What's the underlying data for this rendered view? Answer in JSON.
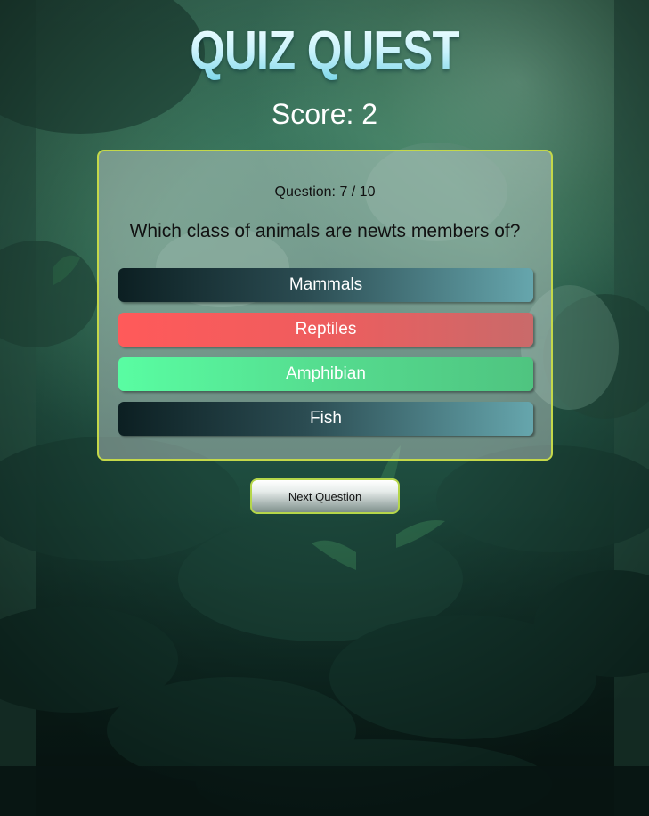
{
  "app": {
    "title": "QUIZ QUEST"
  },
  "score": {
    "text": "Score: 2"
  },
  "quiz": {
    "question_count": "Question: 7 / 10",
    "question": "Which class of animals are newts members of?",
    "answers": [
      {
        "label": "Mammals",
        "state": "neutral"
      },
      {
        "label": "Reptiles",
        "state": "wrong"
      },
      {
        "label": "Amphibian",
        "state": "correct"
      },
      {
        "label": "Fish",
        "state": "neutral"
      }
    ]
  },
  "next_button": {
    "label": "Next Question"
  },
  "colors": {
    "card_border": "#c4d84a",
    "wrong": "#ff5a5a",
    "correct": "#59fda2",
    "neutral_dark": "#0c1f22",
    "neutral_light": "#66a6ad"
  }
}
